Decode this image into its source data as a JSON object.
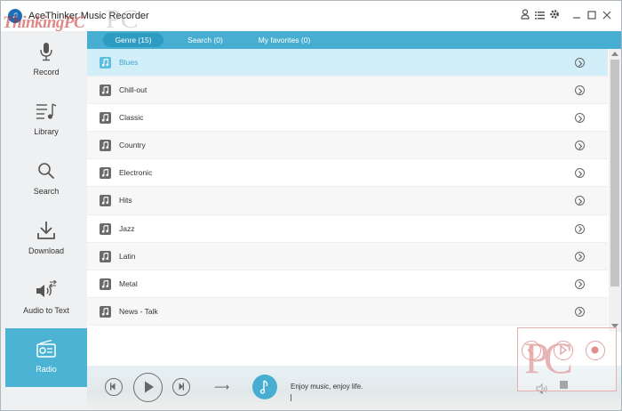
{
  "app": {
    "title": "AceThinker Music Recorder",
    "watermark_text": "ThinkingPC",
    "watermark_pc": "PC"
  },
  "titlebar": {
    "icons": [
      "user-icon",
      "menu-list-icon",
      "gear-icon",
      "minimize-icon",
      "maximize-icon",
      "close-icon"
    ]
  },
  "sidebar": {
    "items": [
      {
        "label": "Record",
        "icon": "microphone-icon"
      },
      {
        "label": "Library",
        "icon": "library-icon"
      },
      {
        "label": "Search",
        "icon": "search-icon"
      },
      {
        "label": "Download",
        "icon": "download-icon"
      },
      {
        "label": "Audio to Text",
        "icon": "audio-to-text-icon"
      },
      {
        "label": "Radio",
        "icon": "radio-icon",
        "active": true
      }
    ]
  },
  "tabs": [
    {
      "label": "Genre (15)",
      "active": true
    },
    {
      "label": "Search (0)"
    },
    {
      "label": "My favorites (0)"
    }
  ],
  "genres": [
    {
      "name": "Blues",
      "selected": true
    },
    {
      "name": "Chill-out"
    },
    {
      "name": "Classic"
    },
    {
      "name": "Country"
    },
    {
      "name": "Electronic"
    },
    {
      "name": "Hits"
    },
    {
      "name": "Jazz"
    },
    {
      "name": "Latin"
    },
    {
      "name": "Metal"
    },
    {
      "name": "News - Talk"
    }
  ],
  "player": {
    "now_playing": "Enjoy music, enjoy life."
  },
  "colors": {
    "accent": "#47aed2",
    "sidebar_active": "#4cb3d4",
    "selected_row": "#d2eef9"
  }
}
